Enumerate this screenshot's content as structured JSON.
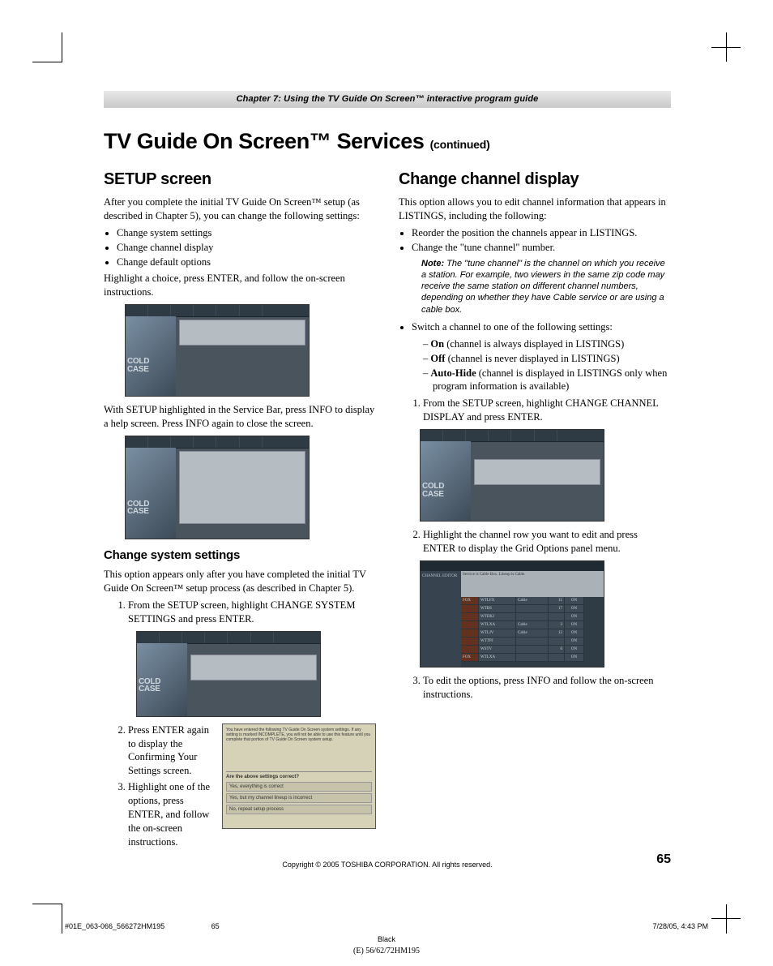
{
  "chapter_bar": "Chapter 7: Using the TV Guide On Screen™ interactive program guide",
  "main_title": "TV Guide On Screen™ Services ",
  "continued": "(continued)",
  "left": {
    "h2": "SETUP screen",
    "intro": "After you complete the initial TV Guide On Screen™ setup (as described in Chapter 5), you can change the following settings:",
    "bullets": [
      "Change system settings",
      "Change channel display",
      "Change default options"
    ],
    "after_bullets": "Highlight a choice, press ENTER, and follow the on-screen instructions.",
    "after_ss1": "With SETUP highlighted in the Service Bar, press INFO to display a help screen. Press INFO again to close the screen.",
    "h3_sys": "Change system settings",
    "sys_intro": "This option appears only after you have completed the initial TV Guide On Screen™ setup process (as described in Chapter 5).",
    "sys_steps": [
      "From the SETUP screen, highlight CHANGE SYSTEM SETTINGS and press ENTER.",
      "Press ENTER again to display the Confirming Your Settings screen.",
      "Highlight one of the options, press ENTER, and follow the on-screen instructions."
    ],
    "confirm": {
      "q": "Are the above settings correct?",
      "opts": [
        "Yes, everything is correct",
        "Yes, but my channel lineup is incorrect",
        "No, repeat setup process"
      ]
    }
  },
  "right": {
    "h2": "Change channel display",
    "intro": "This option allows you to edit channel information that appears in LISTINGS, including the following:",
    "b1": "Reorder the position the channels appear in LISTINGS.",
    "b2": "Change the \"tune channel\" number.",
    "note": "The \"tune channel\" is the channel on which you receive a station. For example, two viewers in the same zip code may receive the same station on different channel numbers, depending on whether they have Cable service or are using a cable box.",
    "note_label": "Note:",
    "b3": "Switch a channel to one of the following settings:",
    "switch_opts": [
      {
        "bold": "On",
        "rest": " (channel is always displayed in LISTINGS)"
      },
      {
        "bold": "Off",
        "rest": " (channel is never displayed in LISTINGS)"
      },
      {
        "bold": "Auto-Hide",
        "rest": " (channel is displayed in LISTINGS only when program information is available)"
      }
    ],
    "steps": [
      "From the SETUP screen, highlight CHANGE CHANNEL DISPLAY and press ENTER.",
      "Highlight the channel row you want to edit and press ENTER to display the Grid Options panel menu.",
      "To edit the options, press INFO and follow the on-screen instructions."
    ],
    "grid": {
      "title": "CHANNEL EDITOR",
      "hdr": "Service is Cable Box. Lineup is Cable.",
      "rows": [
        {
          "logo": "FOX",
          "call": "WTLFX",
          "src": "Cable",
          "num": "11",
          "st": "ON"
        },
        {
          "logo": "",
          "call": "WTBS",
          "src": "",
          "num": "17",
          "st": "ON"
        },
        {
          "logo": "",
          "call": "WTDKJ",
          "src": "",
          "num": "",
          "st": "ON"
        },
        {
          "logo": "",
          "call": "WTLXA",
          "src": "Cable",
          "num": "3",
          "st": "ON"
        },
        {
          "logo": "",
          "call": "WTLJV",
          "src": "Cable",
          "num": "12",
          "st": "ON"
        },
        {
          "logo": "",
          "call": "WTTPJ",
          "src": "",
          "num": "",
          "st": "ON"
        },
        {
          "logo": "",
          "call": "WSTV",
          "src": "",
          "num": "6",
          "st": "ON"
        },
        {
          "logo": "FOX",
          "call": "WTLXA",
          "src": "",
          "num": "",
          "st": "ON"
        }
      ]
    }
  },
  "ss_text": {
    "case": "COLD\nCASE"
  },
  "copyright": "Copyright © 2005 TOSHIBA CORPORATION. All rights reserved.",
  "page_number": "65",
  "footer": {
    "left": "#01E_063-066_566272HM195",
    "center_page": "65",
    "right": "7/28/05, 4:43 PM",
    "black": "Black",
    "model": "(E) 56/62/72HM195"
  }
}
